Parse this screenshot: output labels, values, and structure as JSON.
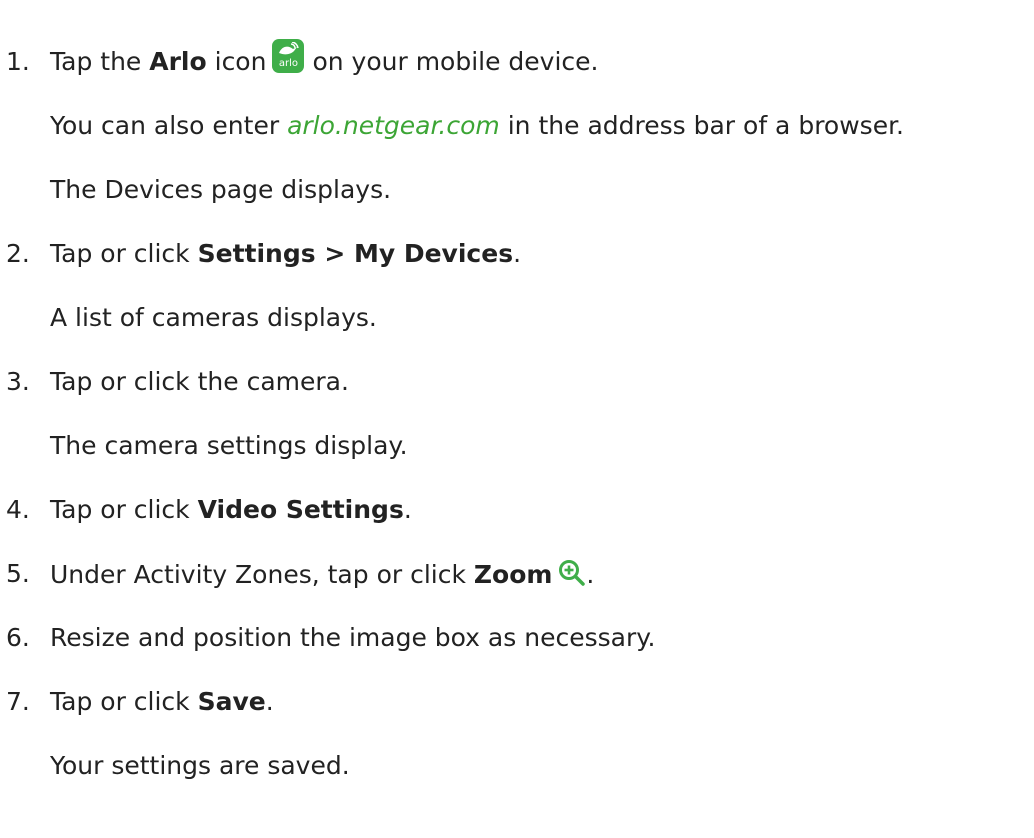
{
  "steps": [
    {
      "num": "1.",
      "pre": "Tap the ",
      "bold": "Arlo",
      "mid": " icon",
      "post": "on your mobile device."
    },
    {
      "num": "2.",
      "pre": "Tap or click ",
      "bold": "Settings > My Devices",
      "post": "."
    },
    {
      "num": "3.",
      "text": "Tap or click the camera."
    },
    {
      "num": "4.",
      "pre": "Tap or click ",
      "bold": "Video Settings",
      "post": "."
    },
    {
      "num": "5.",
      "pre": "Under Activity Zones, tap or click ",
      "bold": "Zoom",
      "post": "."
    },
    {
      "num": "6.",
      "text": "Resize and position the image box as necessary."
    },
    {
      "num": "7.",
      "pre": "Tap or click ",
      "bold": "Save",
      "post": "."
    }
  ],
  "notes": {
    "s1a_pre": "You can also enter ",
    "s1a_link": "arlo.netgear.com",
    "s1a_post": " in the address bar of a browser.",
    "s1b": "The Devices page displays.",
    "s2": "A list of cameras displays.",
    "s3": "The camera settings display.",
    "s7": "Your settings are saved."
  },
  "icons": {
    "arlo_app_label": "arlo",
    "arlo_app_color": "#3fae49",
    "zoom_icon_color": "#3fae49"
  }
}
